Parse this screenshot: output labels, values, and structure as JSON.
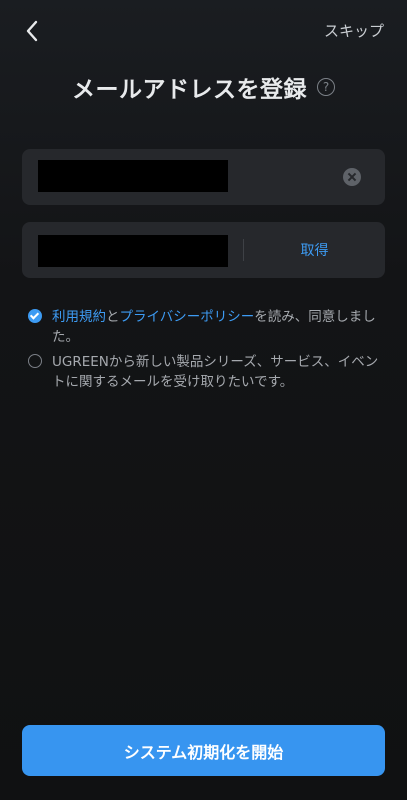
{
  "header": {
    "back_icon": "chevron-left-icon",
    "skip_label": "スキップ",
    "title": "メールアドレスを登録",
    "help_icon_glyph": "?"
  },
  "email_field": {
    "value_redacted": true,
    "clear_icon": "clear-circle-icon"
  },
  "code_field": {
    "value_redacted": true,
    "get_code_label": "取得"
  },
  "consents": {
    "terms": {
      "checked": true,
      "link1": "利用規約",
      "joiner": "と",
      "link2": "プライバシーポリシー",
      "suffix": "を読み、同意しました。"
    },
    "newsletter": {
      "checked": false,
      "text": "UGREENから新しい製品シリーズ、サービス、イベントに関するメールを受け取りたいです。"
    }
  },
  "footer": {
    "start_label": "システム初期化を開始"
  },
  "colors": {
    "accent": "#3795f0",
    "background": "#131416",
    "field_bg": "#26282c"
  }
}
